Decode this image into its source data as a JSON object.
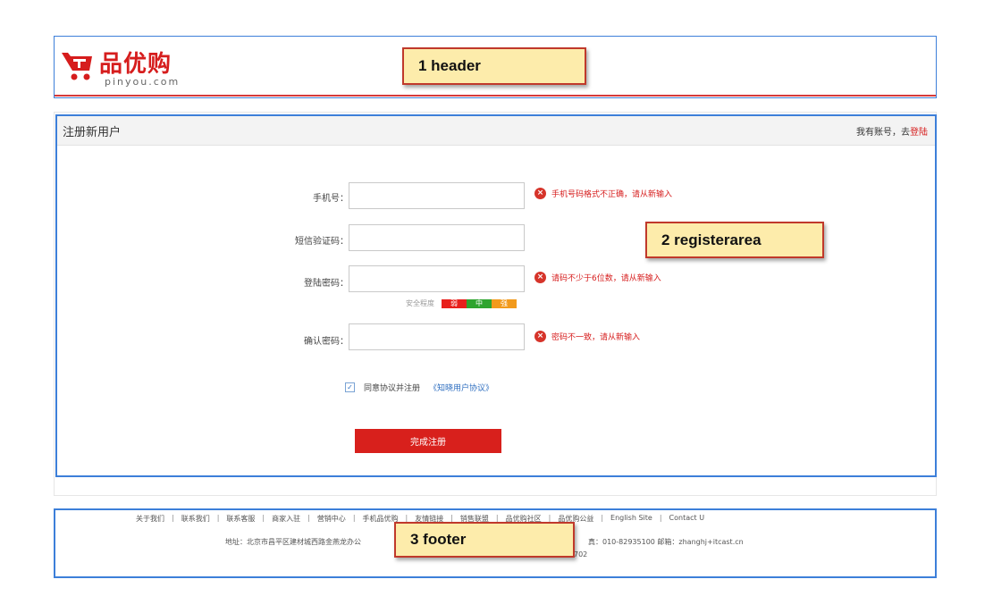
{
  "header": {
    "brand": "品优购",
    "domain": "pinyou.com",
    "annotation": "1 header"
  },
  "register": {
    "title": "注册新用户",
    "login_prompt": "我有账号，去",
    "login_link": "登陆",
    "annotation": "2 registerarea",
    "fields": [
      {
        "label": "手机号：",
        "value": "",
        "error": "手机号码格式不正确，请从新输入"
      },
      {
        "label": "短信验证码：",
        "value": "",
        "error": ""
      },
      {
        "label": "登陆密码：",
        "value": "",
        "error": "请码不少于6位数，请从新输入"
      },
      {
        "label": "确认密码：",
        "value": "",
        "error": "密码不一致，请从新输入"
      }
    ],
    "strength": {
      "label": "安全程度",
      "levels": [
        {
          "text": "弱",
          "color": "#e8201c"
        },
        {
          "text": "中",
          "color": "#2ea42e"
        },
        {
          "text": "强",
          "color": "#f29a1c"
        }
      ]
    },
    "agree_text": "同意协议并注册",
    "agreement_link": "《知晓用户协议》",
    "submit_label": "完成注册"
  },
  "footer": {
    "links": [
      "关于我们",
      "联系我们",
      "联系客服",
      "商家入驻",
      "营销中心",
      "手机品优购",
      "友情链接",
      "销售联盟",
      "品优购社区",
      "品优购公益",
      "English Site",
      "Contact U"
    ],
    "address": "地址：北京市昌平区建材城西路金燕龙办公",
    "phone": "真：010-82935100 邮箱：zhanghj+itcast.cn",
    "icp": "702",
    "annotation": "3 footer"
  },
  "colors": {
    "accent_red": "#d8201c",
    "annotation_border": "#3d7fd9",
    "annotation_fill": "#fdecab"
  }
}
